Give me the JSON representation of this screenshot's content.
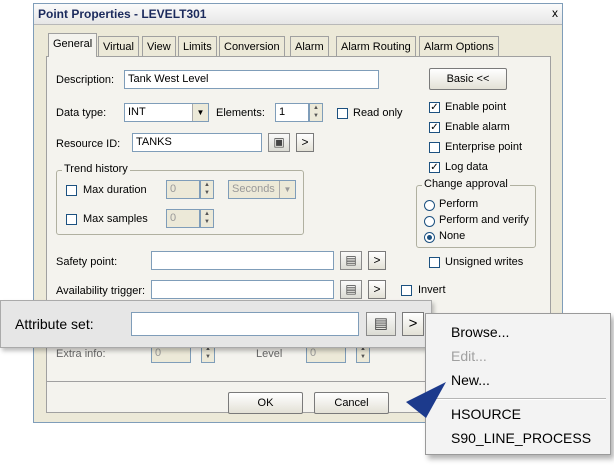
{
  "window": {
    "title": "Point Properties - LEVELT301",
    "close_label": "x"
  },
  "tabs": [
    {
      "label": "General"
    },
    {
      "label": "Virtual"
    },
    {
      "label": "View"
    },
    {
      "label": "Limits"
    },
    {
      "label": "Conversion"
    },
    {
      "label": "Alarm"
    },
    {
      "label": "Alarm Routing"
    },
    {
      "label": "Alarm Options"
    }
  ],
  "general": {
    "description_label": "Description:",
    "description_value": "Tank West Level",
    "basic_button": "Basic <<",
    "data_type_label": "Data type:",
    "data_type_value": "INT",
    "elements_label": "Elements:",
    "elements_value": "1",
    "read_only_label": "Read only",
    "resource_id_label": "Resource ID:",
    "resource_id_value": "TANKS",
    "arrow": ">",
    "trend_history_label": "Trend history",
    "max_duration_label": "Max duration",
    "max_duration_value": "0",
    "duration_unit": "Seconds",
    "max_samples_label": "Max samples",
    "max_samples_value": "0",
    "safety_point_label": "Safety point:",
    "availability_trigger_label": "Availability trigger:",
    "invert_label": "Invert",
    "extra_info_label": "Extra info:",
    "extra_info_value": "0",
    "level_label": "Level",
    "level_value": "0",
    "enable_point_label": "Enable point",
    "enable_alarm_label": "Enable alarm",
    "enterprise_point_label": "Enterprise point",
    "log_data_label": "Log data",
    "change_approval_label": "Change approval",
    "perform_label": "Perform",
    "perform_verify_label": "Perform and verify",
    "none_label": "None",
    "unsigned_writes_label": "Unsigned writes"
  },
  "buttons": {
    "ok": "OK",
    "cancel": "Cancel"
  },
  "zoom": {
    "attribute_set_label": "Attribute set:",
    "attribute_set_value": "",
    "arrow": ">"
  },
  "menu": {
    "items": [
      {
        "label": "Browse..."
      },
      {
        "label": "Edit..."
      },
      {
        "label": "New..."
      },
      {
        "label": "HSOURCE"
      },
      {
        "label": "S90_LINE_PROCESS"
      }
    ]
  },
  "checks": {
    "checked": "✓"
  },
  "colors": {
    "pointer": "#1c3a8c",
    "title_text": "#1b2a5c"
  }
}
